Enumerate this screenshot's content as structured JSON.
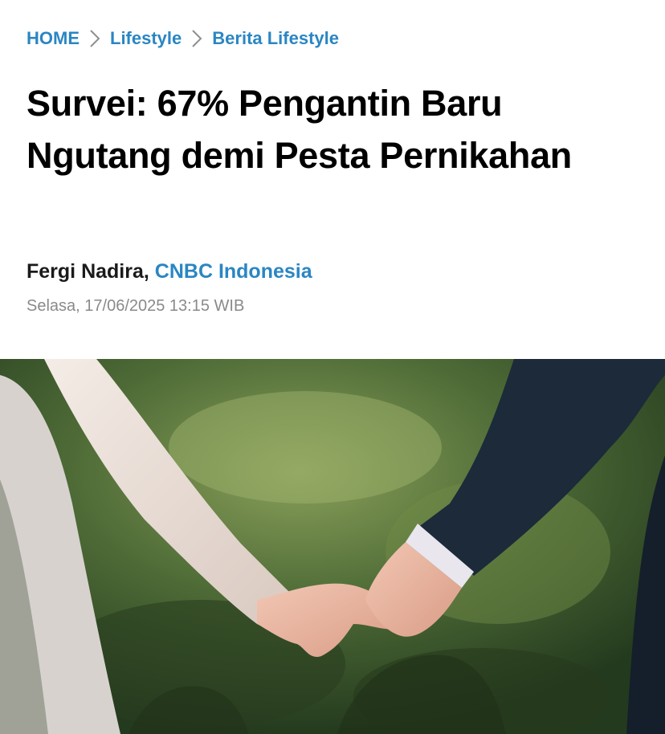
{
  "breadcrumb": {
    "items": [
      {
        "label": "HOME"
      },
      {
        "label": "Lifestyle"
      },
      {
        "label": "Berita Lifestyle"
      }
    ],
    "separator_icon": "chevron-right-icon"
  },
  "article": {
    "title": "Survei: 67% Pengantin Baru Ngutang demi Pesta Pernikahan",
    "author": "Fergi Nadira",
    "author_separator": ",",
    "publisher": "CNBC Indonesia",
    "date": "Selasa, 17/06/2025 13:15 WIB"
  },
  "colors": {
    "link": "#2a86c3",
    "title": "#000000",
    "meta": "#8a8a8a"
  }
}
